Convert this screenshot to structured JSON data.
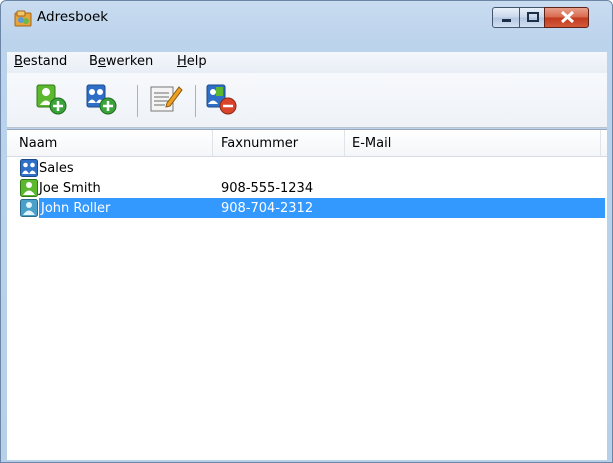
{
  "window": {
    "title": "Adresboek"
  },
  "menu": {
    "items": [
      {
        "pre": "",
        "accel": "B",
        "post": "estand"
      },
      {
        "pre": "B",
        "accel": "e",
        "post": "werken"
      },
      {
        "pre": "",
        "accel": "H",
        "post": "elp"
      }
    ]
  },
  "toolbar": {
    "buttons": [
      "add-contact-icon",
      "add-group-icon",
      "edit-icon",
      "delete-icon"
    ]
  },
  "list": {
    "columns": [
      "Naam",
      "Faxnummer",
      "E-Mail"
    ],
    "rows": [
      {
        "name": "Sales",
        "fax": "",
        "email": "",
        "type": "group",
        "selected": false
      },
      {
        "name": "Joe Smith",
        "fax": "908-555-1234",
        "email": "",
        "type": "contact",
        "selected": false
      },
      {
        "name": "John Roller",
        "fax": "908-704-2312",
        "email": "",
        "type": "contact",
        "selected": true
      }
    ]
  },
  "colors": {
    "selection": "#3399ff",
    "contact_green": "#5cb82e",
    "group_blue": "#2f6fc7"
  }
}
